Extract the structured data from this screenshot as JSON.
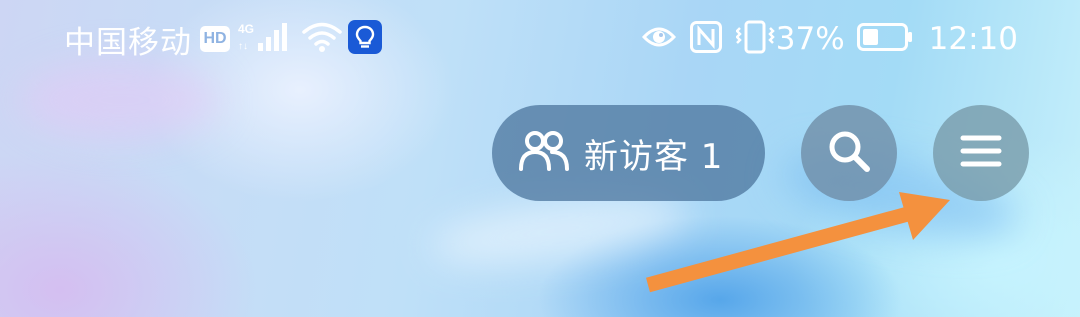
{
  "status_bar": {
    "carrier": "中国移动",
    "hd_badge": "HD",
    "network_type": "4G",
    "battery_percent": "37%",
    "time": "12:10",
    "icons": [
      "hd-icon",
      "signal-4g-icon",
      "wifi-icon",
      "lightbulb-app-icon",
      "eye-icon",
      "nfc-icon",
      "vibrate-icon",
      "battery-icon"
    ]
  },
  "header": {
    "new_visitors_label": "新访客 1",
    "new_visitors_icon": "people-icon",
    "search_icon": "search-icon",
    "menu_icon": "hamburger-menu-icon"
  },
  "annotation": {
    "arrow_icon": "arrow-pointer-icon",
    "arrow_color": "#f4913e"
  },
  "colors": {
    "pill_bg": "#50789f",
    "button_bg": "#6e8ca5",
    "accent_blue": "#1a5ad6"
  }
}
